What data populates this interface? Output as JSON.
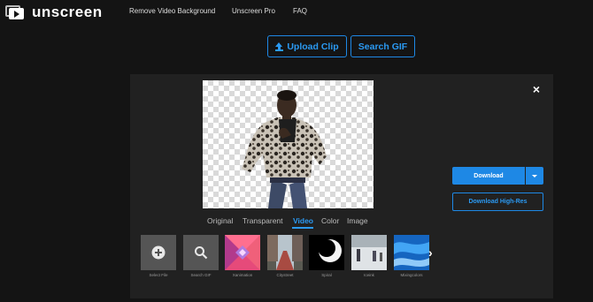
{
  "header": {
    "logo_text": "unscreen",
    "nav": [
      "Remove Video Background",
      "Unscreen Pro",
      "FAQ"
    ]
  },
  "actions": {
    "upload_label": "Upload Clip",
    "search_label": "Search GIF"
  },
  "editor": {
    "close_label": "×",
    "tabs": [
      {
        "label": "Original",
        "active": false
      },
      {
        "label": "Transparent",
        "active": false
      },
      {
        "label": "Video",
        "active": true
      },
      {
        "label": "Color",
        "active": false
      },
      {
        "label": "Image",
        "active": false
      }
    ],
    "download_label": "Download",
    "download_hires_label": "Download High-Res"
  },
  "backgrounds": [
    {
      "label": "Select File",
      "icon": "plus-icon"
    },
    {
      "label": "Search GIF",
      "icon": "search-icon"
    },
    {
      "label": "Xanimation"
    },
    {
      "label": "Citystreet"
    },
    {
      "label": "Spiral"
    },
    {
      "label": "Iceink"
    },
    {
      "label": "Mixingcolors"
    }
  ],
  "colors": {
    "accent": "#1e88e5",
    "accent_text": "#2b9af3",
    "background": "#141414",
    "panel": "#212121"
  }
}
